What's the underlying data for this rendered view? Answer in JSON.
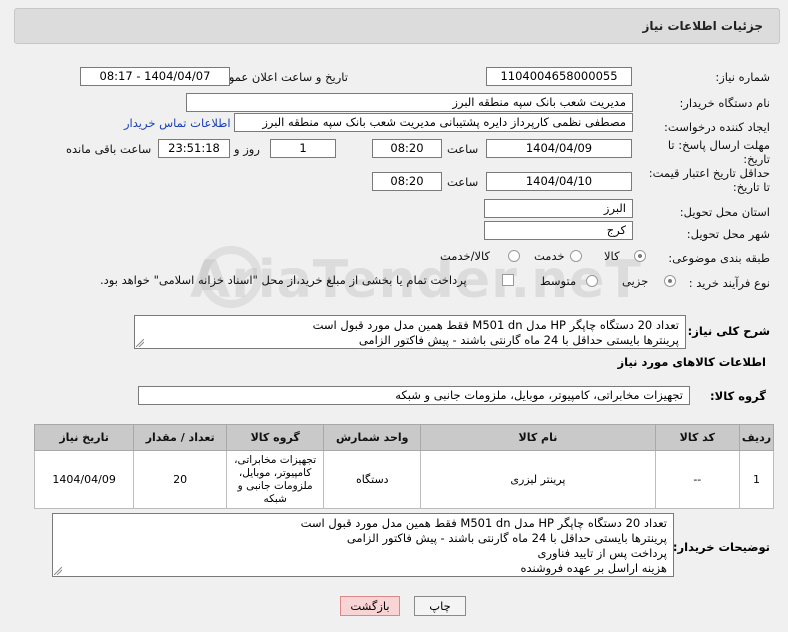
{
  "header": {
    "title": "جزئیات اطلاعات نیاز"
  },
  "form": {
    "need_number_label": "شماره نیاز:",
    "need_number": "1104004658000055",
    "announce_label": "تاریخ و ساعت اعلان عمومی:",
    "announce_value": "1404/04/07 - 08:17",
    "buyer_org_label": "نام دستگاه خریدار:",
    "buyer_org": "مدیریت شعب بانک سپه منطقه البرز",
    "requester_label": "ایجاد کننده درخواست:",
    "requester": "مصطفی نظمی کارپرداز دایره پشتیبانی مدیریت شعب بانک سپه منطقه البرز",
    "contact_link": "اطلاعات تماس خریدار",
    "reply_deadline_label_1": "مهلت ارسال پاسخ: تا",
    "reply_deadline_label_2": "تاریخ:",
    "reply_date": "1404/04/09",
    "time_label": "ساعت",
    "reply_time": "08:20",
    "days_value": "1",
    "days_label": "روز و",
    "remaining_time": "23:51:18",
    "remaining_label": "ساعت باقی مانده",
    "price_validity_label_1": "حداقل تاریخ اعتبار قیمت:",
    "price_validity_label_2": "تا تاریخ:",
    "validity_date": "1404/04/10",
    "validity_time": "08:20",
    "province_label": "استان محل تحویل:",
    "province": "البرز",
    "city_label": "شهر محل تحویل:",
    "city": "کرج",
    "category_label": "طبقه بندی موضوعی:",
    "category_options": [
      "کالا",
      "خدمت",
      "کالا/خدمت"
    ],
    "category_selected": "کالا",
    "process_label": "نوع فرآیند خرید :",
    "process_options": [
      "جزیی",
      "متوسط"
    ],
    "process_selected": "جزیی",
    "payment_note": "پرداخت تمام یا بخشی از مبلغ خرید،از محل \"اسناد خزانه اسلامی\" خواهد بود.",
    "description_label": "شرح کلی نیاز:",
    "description_lines": [
      "تعداد 20 دستگاه چاپگر HP مدل M501 dn فقط همین مدل مورد قبول است",
      "پرینترها بایستی حداقل با 24 ماه گارنتی باشند - پیش فاکتور الزامی"
    ]
  },
  "goods": {
    "section_title": "اطلاعات کالاهای مورد نیاز",
    "group_label": "گروه کالا:",
    "group_value": "تجهیزات مخابراتی، کامپیوتر، موبایل، ملزومات جانبی و شبکه",
    "columns": [
      "ردیف",
      "کد کالا",
      "نام کالا",
      "واحد شمارش",
      "گروه کالا",
      "تعداد / مقدار",
      "تاریخ نیاز"
    ],
    "rows": [
      {
        "row": "1",
        "code": "--",
        "name": "پرینتر لیزری",
        "unit": "دستگاه",
        "group_lines": [
          "تجهیزات مخابراتی،",
          "کامپیوتر، موبایل،",
          "ملزومات جانبی و",
          "شبکه"
        ],
        "qty": "20",
        "date": "1404/04/09"
      }
    ]
  },
  "buyer_notes": {
    "label": "توضیحات خریدار:",
    "lines": [
      "تعداد 20 دستگاه چاپگر HP مدل M501 dn فقط همین مدل مورد قبول است",
      "پرینترها بایستی حداقل با 24 ماه گارنتی باشند - پیش فاکتور الزامی",
      "پرداخت پس از تایید فناوری",
      "هزینه اراسل بر عهده فروشنده"
    ]
  },
  "buttons": {
    "print": "چاپ",
    "back": "بازگشت"
  },
  "colors": {
    "back_button_bg": "#f8d4d4",
    "back_button_border": "#d88a8a",
    "link": "#1a3fb5"
  }
}
